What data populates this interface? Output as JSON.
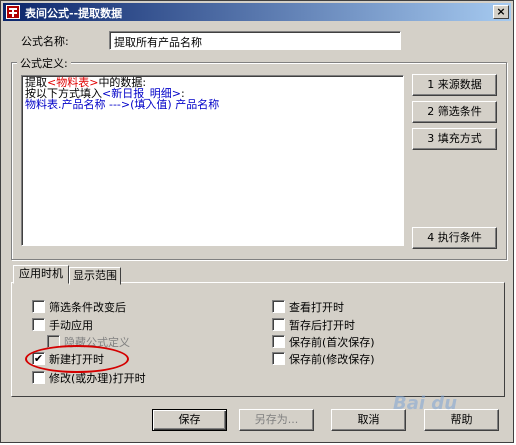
{
  "window": {
    "title": "表间公式--提取数据",
    "close_glyph": "×"
  },
  "formula_name": {
    "label": "公式名称:",
    "value": "提取所有产品名称"
  },
  "formula_def": {
    "label": "公式定义:",
    "lines": [
      {
        "parts": [
          "提取",
          "<物料表>",
          "中的数据:"
        ]
      },
      {
        "parts": [
          "按以下方式填入",
          "<新日报_明细>",
          ":"
        ]
      },
      {
        "text": "物料表.产品名称  --->(填入值)  产品名称"
      }
    ]
  },
  "side_buttons": [
    "1  来源数据",
    "2  筛选条件",
    "3  填充方式",
    "4  执行条件"
  ],
  "tabs": [
    "应用时机",
    "显示范围"
  ],
  "options_left": [
    {
      "label": "筛选条件改变后",
      "checked": false,
      "disabled": false
    },
    {
      "label": "手动应用",
      "checked": false,
      "disabled": false
    },
    {
      "label": "隐藏公式定义",
      "checked": false,
      "disabled": true
    },
    {
      "label": "新建打开时",
      "checked": true,
      "disabled": false
    },
    {
      "label": "修改(或办理)打开时",
      "checked": false,
      "disabled": false
    }
  ],
  "options_right": [
    {
      "label": "查看打开时",
      "checked": false
    },
    {
      "label": "暂存后打开时",
      "checked": false
    },
    {
      "label": "保存前(首次保存)",
      "checked": false
    },
    {
      "label": "保存前(修改保存)",
      "checked": false
    }
  ],
  "check_glyph": "✔",
  "bottom_buttons": {
    "save": "保存",
    "save_as": "另存为...",
    "cancel": "取消",
    "help": "帮助"
  },
  "watermark": "Bai du"
}
